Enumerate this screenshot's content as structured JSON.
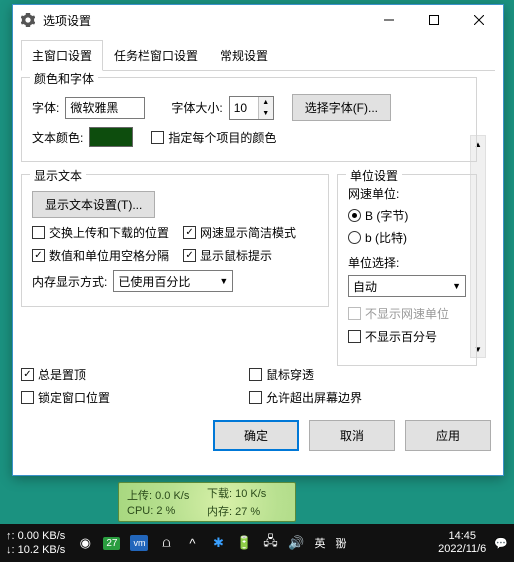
{
  "window": {
    "title": "选项设置"
  },
  "tabs": {
    "main": "主窗口设置",
    "taskbar": "任务栏窗口设置",
    "general": "常规设置"
  },
  "colorfont": {
    "legend": "颜色和字体",
    "font_label": "字体:",
    "font_value": "微软雅黑",
    "fontsize_label": "字体大小:",
    "fontsize_value": "10",
    "choosefont_btn": "选择字体(F)...",
    "textcolor_label": "文本颜色:",
    "color_hex": "#0d4d0d",
    "per_item_color": "指定每个项目的颜色"
  },
  "displaytext": {
    "legend": "显示文本",
    "settings_btn": "显示文本设置(T)...",
    "swap_updown": "交换上传和下载的位置",
    "compact_mode": "网速显示简洁模式",
    "space_sep": "数值和单位用空格分隔",
    "mouse_tip": "显示鼠标提示",
    "mem_label": "内存显示方式:",
    "mem_value": "已使用百分比"
  },
  "unit": {
    "legend": "单位设置",
    "speed_unit_label": "网速单位:",
    "byte": "B (字节)",
    "bit": "b (比特)",
    "unit_select_label": "单位选择:",
    "unit_select_value": "自动",
    "hide_net_unit": "不显示网速单位",
    "hide_percent": "不显示百分号"
  },
  "bottom": {
    "always_top": "总是置顶",
    "mouse_through": "鼠标穿透",
    "lock_pos": "锁定窗口位置",
    "allow_offscreen": "允许超出屏幕边界"
  },
  "buttons": {
    "ok": "确定",
    "cancel": "取消",
    "apply": "应用"
  },
  "overlay": {
    "upload_label": "上传:",
    "upload_val": "0.0 K/s",
    "download_label": "下载:",
    "download_val": "10 K/s",
    "cpu_label": "CPU:",
    "cpu_val": "2 %",
    "mem_label": "内存:",
    "mem_val": "27 %"
  },
  "taskbar": {
    "up_speed": "↑: 0.00 KB/s",
    "down_speed": "↓: 10.2 KB/s",
    "badge": "27",
    "ime1": "英",
    "ime2": "翂",
    "time": "14:45",
    "date": "2022/11/6"
  }
}
